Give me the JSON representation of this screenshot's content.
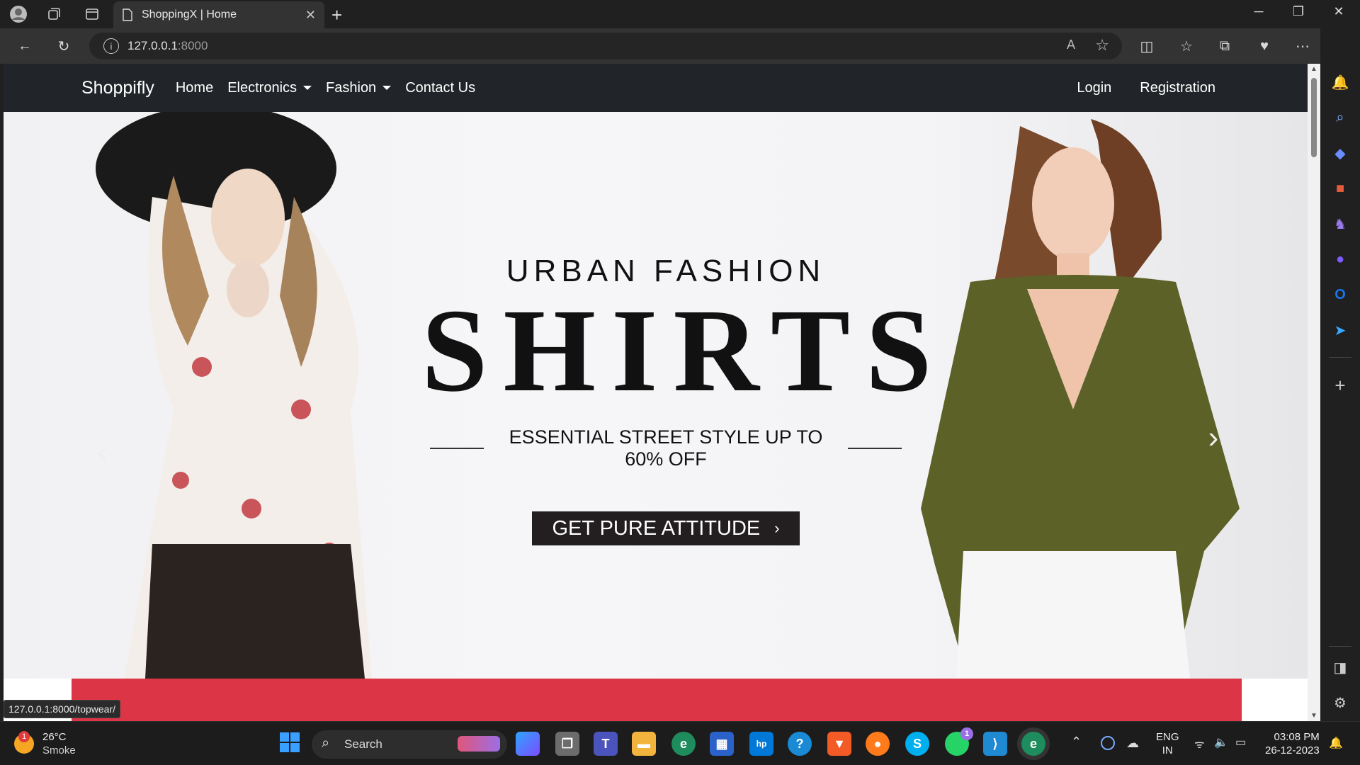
{
  "browser": {
    "tab_title": "ShoppingX | Home",
    "url_host": "127.0.0.1",
    "url_port": ":8000",
    "status_url": "127.0.0.1:8000/topwear/"
  },
  "site": {
    "brand": "Shoppifly",
    "nav": {
      "home": "Home",
      "electronics": "Electronics",
      "fashion": "Fashion",
      "contact": "Contact Us",
      "login": "Login",
      "registration": "Registration"
    },
    "hero": {
      "subhead": "URBAN FASHION",
      "headline": "SHIRTS",
      "tagline": "ESSENTIAL STREET STYLE UP TO 60% OFF",
      "cta": "GET PURE ATTITUDE"
    },
    "accent_color": "#dc3545"
  },
  "taskbar": {
    "weather_temp": "26°C",
    "weather_desc": "Smoke",
    "weather_badge": "1",
    "search_label": "Search",
    "whatsapp_badge": "1",
    "lang_top": "ENG",
    "lang_bottom": "IN",
    "time": "03:08 PM",
    "date": "26-12-2023"
  }
}
